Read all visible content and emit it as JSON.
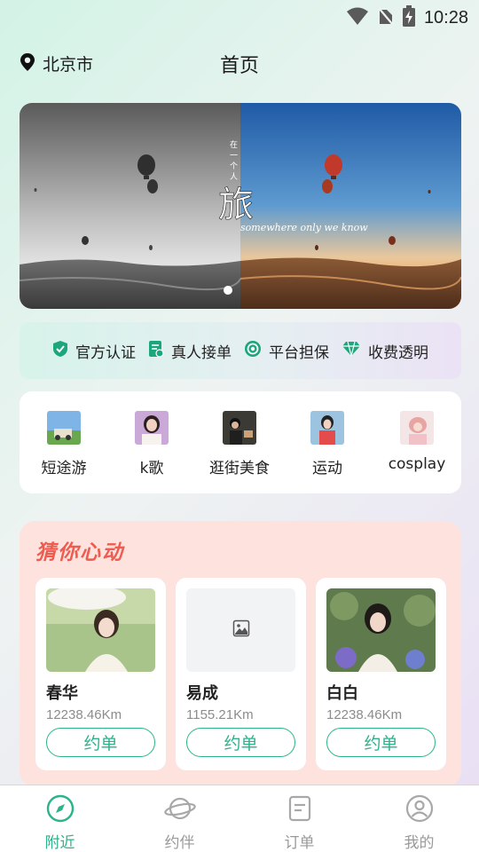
{
  "status_bar": {
    "time": "10:28"
  },
  "header": {
    "location": "北京市",
    "title": "首页"
  },
  "banner": {
    "vertical_caption": "在一个人的旅行",
    "title_glyph": "旅",
    "subtitle": "somewhere only we know"
  },
  "guarantees": [
    {
      "icon": "shield-check-icon",
      "label": "官方认证"
    },
    {
      "icon": "document-check-icon",
      "label": "真人接单"
    },
    {
      "icon": "coin-icon",
      "label": "平台担保"
    },
    {
      "icon": "diamond-icon",
      "label": "收费透明"
    }
  ],
  "categories": [
    {
      "label": "短途游"
    },
    {
      "label": "k歌"
    },
    {
      "label": "逛街美食"
    },
    {
      "label": "运动"
    },
    {
      "label": "cosplay"
    }
  ],
  "recommend": {
    "title": "猜你心动",
    "cards": [
      {
        "name": "春华",
        "distance": "12238.46Km",
        "button": "约单"
      },
      {
        "name": "易成",
        "distance": "1155.21Km",
        "button": "约单"
      },
      {
        "name": "白白",
        "distance": "12238.46Km",
        "button": "约单"
      }
    ]
  },
  "tabbar": [
    {
      "label": "附近",
      "active": true
    },
    {
      "label": "约伴",
      "active": false
    },
    {
      "label": "订单",
      "active": false
    },
    {
      "label": "我的",
      "active": false
    }
  ],
  "colors": {
    "accent": "#2bb38a",
    "rec_title": "#ef5c4f",
    "rec_bg": "#fde2dd"
  }
}
